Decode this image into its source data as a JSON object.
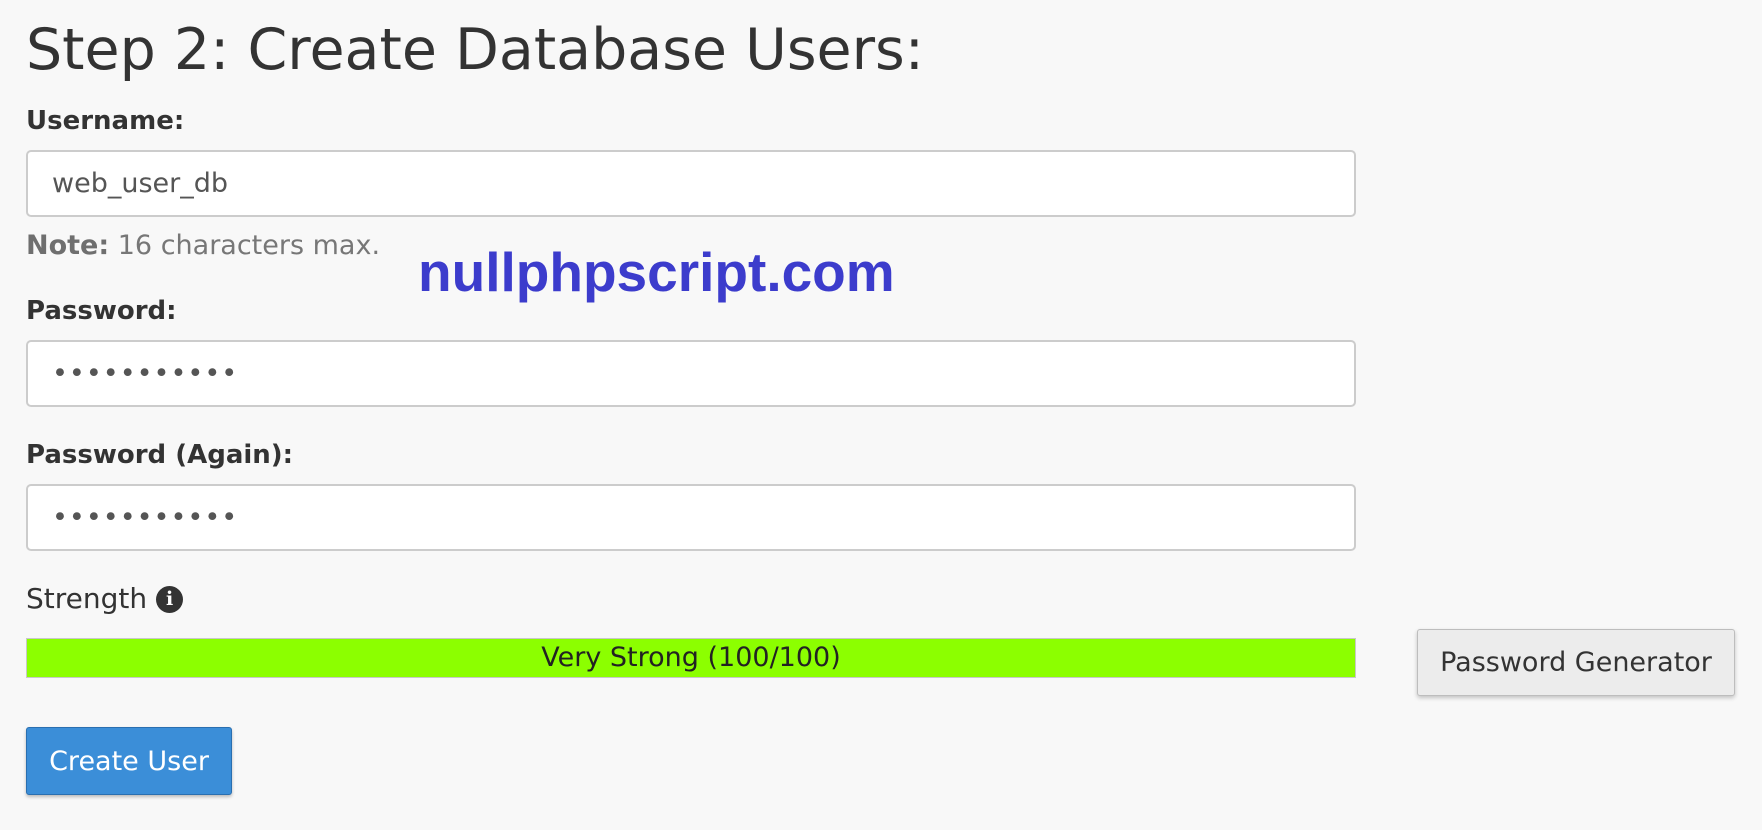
{
  "form": {
    "title": "Step 2: Create Database Users:",
    "username": {
      "label": "Username:",
      "value": "web_user_db",
      "note_prefix": "Note:",
      "note_text": " 16 characters max."
    },
    "password": {
      "label": "Password:",
      "value": "•••••••••••"
    },
    "password_again": {
      "label": "Password (Again):",
      "value": "•••••••••••"
    },
    "strength": {
      "label": "Strength",
      "icon": "info-circle-icon",
      "text": "Very Strong (100/100)",
      "score": 100,
      "max": 100,
      "color": "#8cff00"
    },
    "password_generator_label": "Password Generator",
    "create_button_label": "Create User"
  },
  "watermark": {
    "text": "nullphpscript.com",
    "color": "#3c3ccc"
  },
  "colors": {
    "primary_button": "#3b8ed8",
    "background": "#f8f8f8"
  }
}
